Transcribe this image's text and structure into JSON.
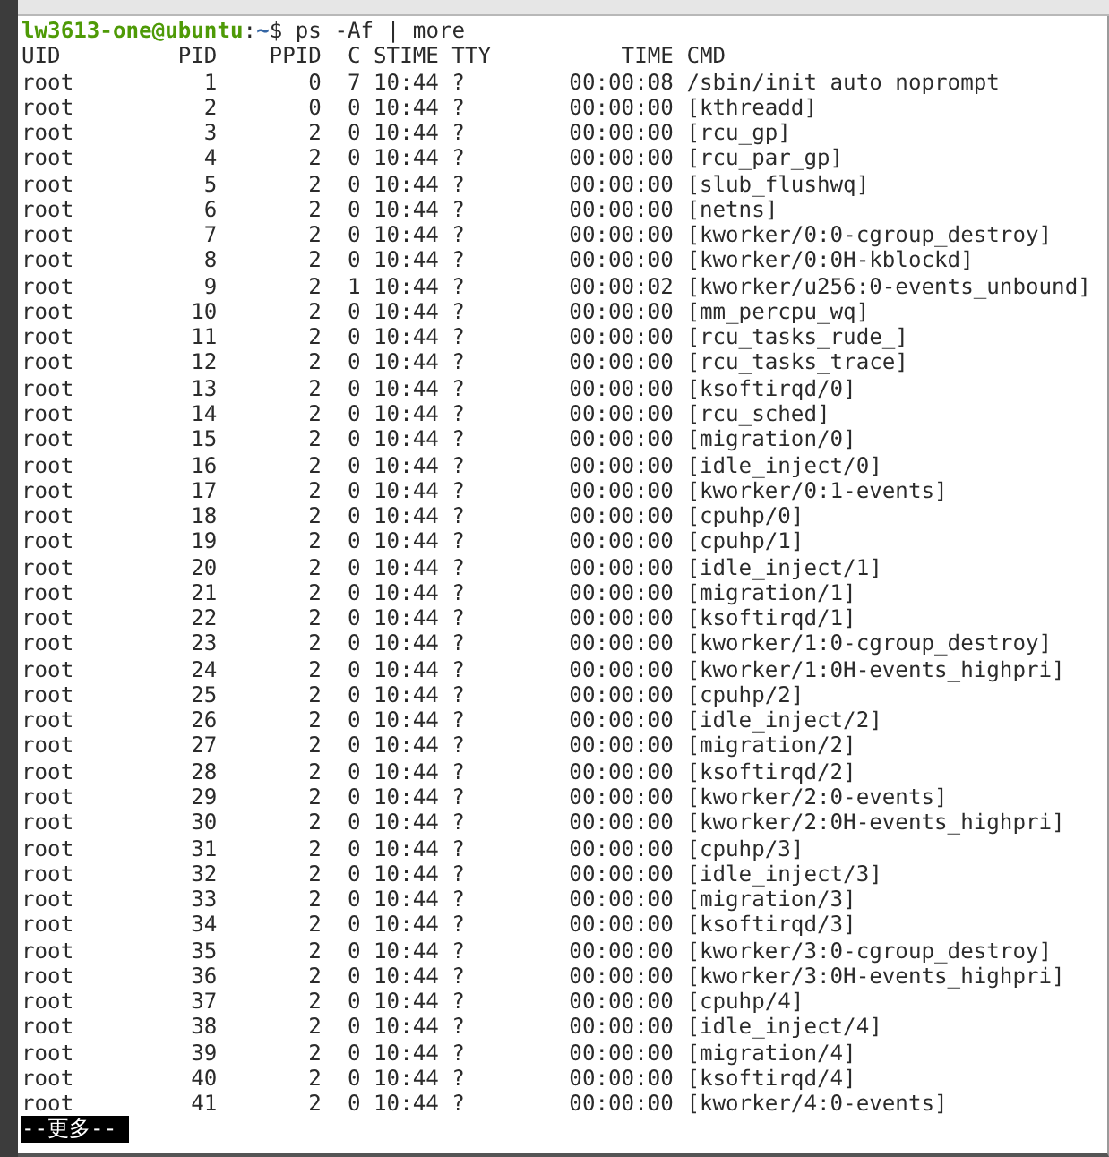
{
  "prompt": {
    "user_host": "lw3613-one@ubuntu",
    "separator": ":",
    "path": "~",
    "symbol": "$",
    "command": "ps -Af | more"
  },
  "table": {
    "columns": [
      "UID",
      "PID",
      "PPID",
      "C",
      "STIME",
      "TTY",
      "TIME",
      "CMD"
    ],
    "rows": [
      [
        "root",
        "1",
        "0",
        "7",
        "10:44",
        "?",
        "00:00:08",
        "/sbin/init auto noprompt"
      ],
      [
        "root",
        "2",
        "0",
        "0",
        "10:44",
        "?",
        "00:00:00",
        "[kthreadd]"
      ],
      [
        "root",
        "3",
        "2",
        "0",
        "10:44",
        "?",
        "00:00:00",
        "[rcu_gp]"
      ],
      [
        "root",
        "4",
        "2",
        "0",
        "10:44",
        "?",
        "00:00:00",
        "[rcu_par_gp]"
      ],
      [
        "root",
        "5",
        "2",
        "0",
        "10:44",
        "?",
        "00:00:00",
        "[slub_flushwq]"
      ],
      [
        "root",
        "6",
        "2",
        "0",
        "10:44",
        "?",
        "00:00:00",
        "[netns]"
      ],
      [
        "root",
        "7",
        "2",
        "0",
        "10:44",
        "?",
        "00:00:00",
        "[kworker/0:0-cgroup_destroy]"
      ],
      [
        "root",
        "8",
        "2",
        "0",
        "10:44",
        "?",
        "00:00:00",
        "[kworker/0:0H-kblockd]"
      ],
      [
        "root",
        "9",
        "2",
        "1",
        "10:44",
        "?",
        "00:00:02",
        "[kworker/u256:0-events_unbound]"
      ],
      [
        "root",
        "10",
        "2",
        "0",
        "10:44",
        "?",
        "00:00:00",
        "[mm_percpu_wq]"
      ],
      [
        "root",
        "11",
        "2",
        "0",
        "10:44",
        "?",
        "00:00:00",
        "[rcu_tasks_rude_]"
      ],
      [
        "root",
        "12",
        "2",
        "0",
        "10:44",
        "?",
        "00:00:00",
        "[rcu_tasks_trace]"
      ],
      [
        "root",
        "13",
        "2",
        "0",
        "10:44",
        "?",
        "00:00:00",
        "[ksoftirqd/0]"
      ],
      [
        "root",
        "14",
        "2",
        "0",
        "10:44",
        "?",
        "00:00:00",
        "[rcu_sched]"
      ],
      [
        "root",
        "15",
        "2",
        "0",
        "10:44",
        "?",
        "00:00:00",
        "[migration/0]"
      ],
      [
        "root",
        "16",
        "2",
        "0",
        "10:44",
        "?",
        "00:00:00",
        "[idle_inject/0]"
      ],
      [
        "root",
        "17",
        "2",
        "0",
        "10:44",
        "?",
        "00:00:00",
        "[kworker/0:1-events]"
      ],
      [
        "root",
        "18",
        "2",
        "0",
        "10:44",
        "?",
        "00:00:00",
        "[cpuhp/0]"
      ],
      [
        "root",
        "19",
        "2",
        "0",
        "10:44",
        "?",
        "00:00:00",
        "[cpuhp/1]"
      ],
      [
        "root",
        "20",
        "2",
        "0",
        "10:44",
        "?",
        "00:00:00",
        "[idle_inject/1]"
      ],
      [
        "root",
        "21",
        "2",
        "0",
        "10:44",
        "?",
        "00:00:00",
        "[migration/1]"
      ],
      [
        "root",
        "22",
        "2",
        "0",
        "10:44",
        "?",
        "00:00:00",
        "[ksoftirqd/1]"
      ],
      [
        "root",
        "23",
        "2",
        "0",
        "10:44",
        "?",
        "00:00:00",
        "[kworker/1:0-cgroup_destroy]"
      ],
      [
        "root",
        "24",
        "2",
        "0",
        "10:44",
        "?",
        "00:00:00",
        "[kworker/1:0H-events_highpri]"
      ],
      [
        "root",
        "25",
        "2",
        "0",
        "10:44",
        "?",
        "00:00:00",
        "[cpuhp/2]"
      ],
      [
        "root",
        "26",
        "2",
        "0",
        "10:44",
        "?",
        "00:00:00",
        "[idle_inject/2]"
      ],
      [
        "root",
        "27",
        "2",
        "0",
        "10:44",
        "?",
        "00:00:00",
        "[migration/2]"
      ],
      [
        "root",
        "28",
        "2",
        "0",
        "10:44",
        "?",
        "00:00:00",
        "[ksoftirqd/2]"
      ],
      [
        "root",
        "29",
        "2",
        "0",
        "10:44",
        "?",
        "00:00:00",
        "[kworker/2:0-events]"
      ],
      [
        "root",
        "30",
        "2",
        "0",
        "10:44",
        "?",
        "00:00:00",
        "[kworker/2:0H-events_highpri]"
      ],
      [
        "root",
        "31",
        "2",
        "0",
        "10:44",
        "?",
        "00:00:00",
        "[cpuhp/3]"
      ],
      [
        "root",
        "32",
        "2",
        "0",
        "10:44",
        "?",
        "00:00:00",
        "[idle_inject/3]"
      ],
      [
        "root",
        "33",
        "2",
        "0",
        "10:44",
        "?",
        "00:00:00",
        "[migration/3]"
      ],
      [
        "root",
        "34",
        "2",
        "0",
        "10:44",
        "?",
        "00:00:00",
        "[ksoftirqd/3]"
      ],
      [
        "root",
        "35",
        "2",
        "0",
        "10:44",
        "?",
        "00:00:00",
        "[kworker/3:0-cgroup_destroy]"
      ],
      [
        "root",
        "36",
        "2",
        "0",
        "10:44",
        "?",
        "00:00:00",
        "[kworker/3:0H-events_highpri]"
      ],
      [
        "root",
        "37",
        "2",
        "0",
        "10:44",
        "?",
        "00:00:00",
        "[cpuhp/4]"
      ],
      [
        "root",
        "38",
        "2",
        "0",
        "10:44",
        "?",
        "00:00:00",
        "[idle_inject/4]"
      ],
      [
        "root",
        "39",
        "2",
        "0",
        "10:44",
        "?",
        "00:00:00",
        "[migration/4]"
      ],
      [
        "root",
        "40",
        "2",
        "0",
        "10:44",
        "?",
        "00:00:00",
        "[ksoftirqd/4]"
      ],
      [
        "root",
        "41",
        "2",
        "0",
        "10:44",
        "?",
        "00:00:00",
        "[kworker/4:0-events]"
      ]
    ]
  },
  "pager": {
    "text": "--更多--"
  }
}
